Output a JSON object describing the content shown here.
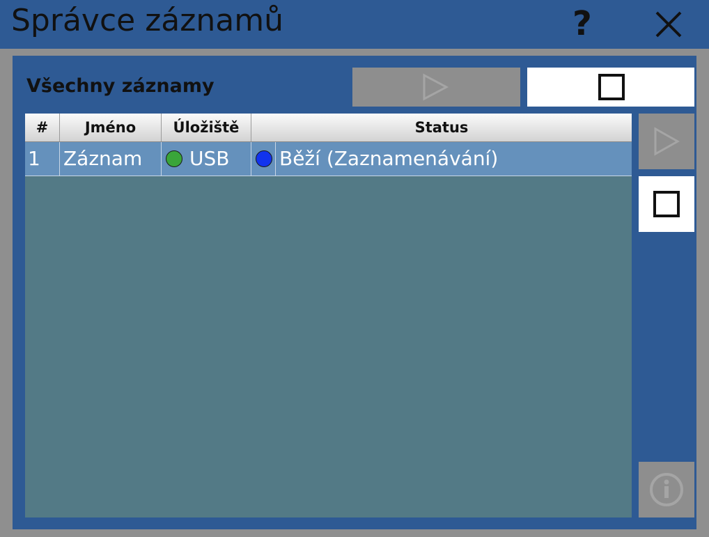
{
  "window": {
    "title": "Správce záznamů",
    "help_label": "?"
  },
  "panel": {
    "section_title": "Všechny záznamy"
  },
  "table": {
    "columns": [
      "#",
      "Jméno",
      "Úložiště",
      "Status"
    ],
    "rows": [
      {
        "index": "1",
        "name": "Záznam",
        "storage": "USB",
        "storage_color": "#3aa53a",
        "status": "Běží (Zaznamenávání)",
        "status_color": "#1133ee"
      }
    ]
  },
  "colors": {
    "window_bg": "#2e5a94",
    "table_bg": "#537a86",
    "selected_row": "#6591bc",
    "disabled_button": "#8e8e8e"
  },
  "icons": {
    "help": "question-mark-icon",
    "close": "close-icon",
    "play": "play-icon",
    "stop": "stop-icon",
    "info": "info-icon"
  }
}
